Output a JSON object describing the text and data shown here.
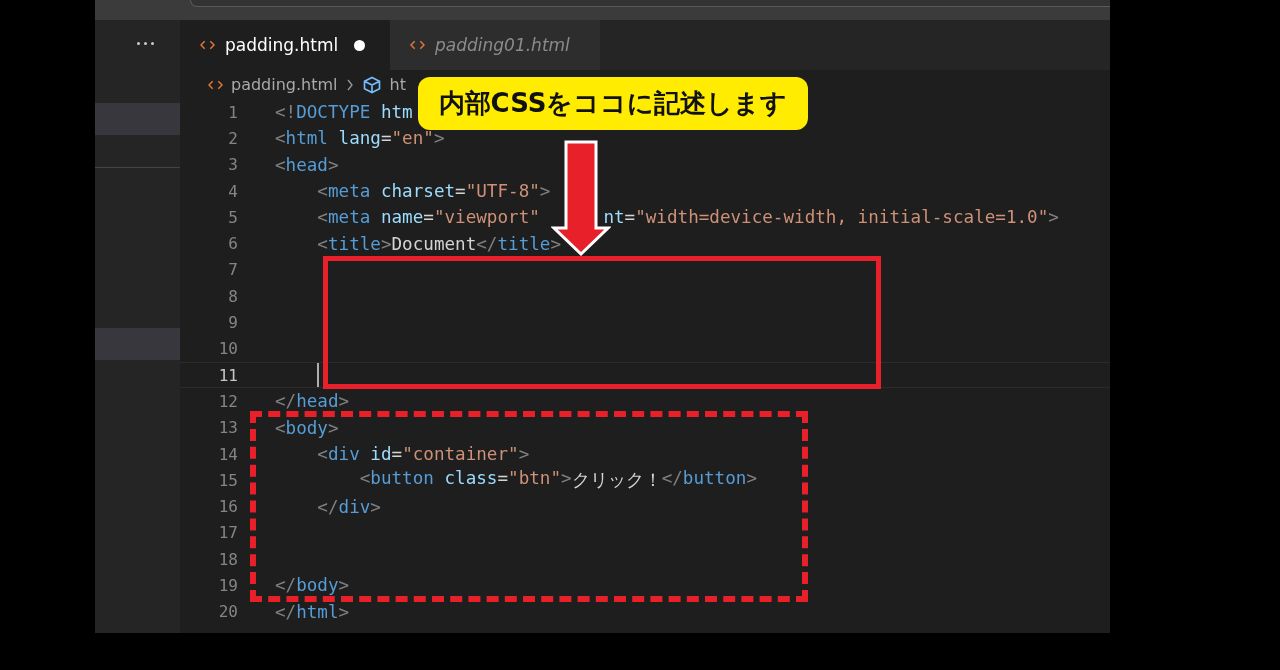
{
  "tabs": [
    {
      "label": "padding.html",
      "selected": true,
      "modified": true,
      "preview": false
    },
    {
      "label": "padding01.html",
      "selected": false,
      "modified": false,
      "preview": true
    }
  ],
  "breadcrumb": [
    "padding.html",
    "ht"
  ],
  "code_lines": [
    {
      "number": "1",
      "current": false,
      "tokens": [
        {
          "kind": "punct",
          "text": "<!"
        },
        {
          "kind": "tag",
          "text": "DOCTYPE"
        },
        {
          "kind": "attr",
          "text": " htm"
        }
      ]
    },
    {
      "number": "2",
      "current": false,
      "tokens": [
        {
          "kind": "punct",
          "text": "<"
        },
        {
          "kind": "tag",
          "text": "html"
        },
        {
          "kind": "attr",
          "text": " lang"
        },
        {
          "kind": "text",
          "text": "="
        },
        {
          "kind": "str",
          "text": "\"en\""
        },
        {
          "kind": "punct",
          "text": ">"
        }
      ]
    },
    {
      "number": "3",
      "current": false,
      "tokens": [
        {
          "kind": "punct",
          "text": "<"
        },
        {
          "kind": "tag",
          "text": "head"
        },
        {
          "kind": "punct",
          "text": ">"
        }
      ]
    },
    {
      "number": "4",
      "current": false,
      "tokens": [
        {
          "kind": "punct",
          "text": "    <"
        },
        {
          "kind": "tag",
          "text": "meta"
        },
        {
          "kind": "attr",
          "text": " charset"
        },
        {
          "kind": "text",
          "text": "="
        },
        {
          "kind": "str",
          "text": "\"UTF-8\""
        },
        {
          "kind": "punct",
          "text": ">"
        }
      ]
    },
    {
      "number": "5",
      "current": false,
      "tokens": [
        {
          "kind": "punct",
          "text": "    <"
        },
        {
          "kind": "tag",
          "text": "meta"
        },
        {
          "kind": "attr",
          "text": " name"
        },
        {
          "kind": "text",
          "text": "="
        },
        {
          "kind": "str",
          "text": "\"viewport\""
        },
        {
          "kind": "gap"
        },
        {
          "kind": "attr",
          "text": "nt"
        },
        {
          "kind": "text",
          "text": "="
        },
        {
          "kind": "str",
          "text": "\"width=device-width, initial-scale=1.0\""
        },
        {
          "kind": "punct",
          "text": ">"
        }
      ]
    },
    {
      "number": "6",
      "current": false,
      "tokens": [
        {
          "kind": "punct",
          "text": "    <"
        },
        {
          "kind": "tag",
          "text": "title"
        },
        {
          "kind": "punct",
          "text": ">"
        },
        {
          "kind": "text",
          "text": "Document"
        },
        {
          "kind": "punct",
          "text": "</"
        },
        {
          "kind": "tag",
          "text": "title"
        },
        {
          "kind": "punct",
          "text": ">"
        }
      ]
    },
    {
      "number": "7",
      "current": false
    },
    {
      "number": "8",
      "current": false
    },
    {
      "number": "9",
      "current": false
    },
    {
      "number": "10",
      "current": false
    },
    {
      "number": "11",
      "current": true
    },
    {
      "number": "12",
      "current": false,
      "tokens": [
        {
          "kind": "punct",
          "text": "</"
        },
        {
          "kind": "tag",
          "text": "head"
        },
        {
          "kind": "punct",
          "text": ">"
        }
      ]
    },
    {
      "number": "13",
      "current": false,
      "tokens": [
        {
          "kind": "punct",
          "text": "<"
        },
        {
          "kind": "tag",
          "text": "body"
        },
        {
          "kind": "punct",
          "text": ">"
        }
      ]
    },
    {
      "number": "14",
      "current": false,
      "tokens": [
        {
          "kind": "punct",
          "text": "    <"
        },
        {
          "kind": "tag",
          "text": "div"
        },
        {
          "kind": "attr",
          "text": " id"
        },
        {
          "kind": "text",
          "text": "="
        },
        {
          "kind": "str",
          "text": "\"container\""
        },
        {
          "kind": "punct",
          "text": ">"
        }
      ]
    },
    {
      "number": "15",
      "current": false,
      "tokens": [
        {
          "kind": "punct",
          "text": "        <"
        },
        {
          "kind": "tag",
          "text": "button"
        },
        {
          "kind": "attr",
          "text": " class"
        },
        {
          "kind": "text",
          "text": "="
        },
        {
          "kind": "str",
          "text": "\"btn\""
        },
        {
          "kind": "punct",
          "text": ">"
        },
        {
          "kind": "text",
          "text": "クリック！"
        },
        {
          "kind": "punct",
          "text": "</"
        },
        {
          "kind": "tag",
          "text": "button"
        },
        {
          "kind": "punct",
          "text": ">"
        }
      ]
    },
    {
      "number": "16",
      "current": false,
      "tokens": [
        {
          "kind": "punct",
          "text": "    </"
        },
        {
          "kind": "tag",
          "text": "div"
        },
        {
          "kind": "punct",
          "text": ">"
        }
      ]
    },
    {
      "number": "17",
      "current": false
    },
    {
      "number": "18",
      "current": false
    },
    {
      "number": "19",
      "current": false,
      "tokens": [
        {
          "kind": "punct",
          "text": "</"
        },
        {
          "kind": "tag",
          "text": "body"
        },
        {
          "kind": "punct",
          "text": ">"
        }
      ]
    },
    {
      "number": "20",
      "current": false,
      "tokens": [
        {
          "kind": "punct",
          "text": "</"
        },
        {
          "kind": "tag",
          "text": "html"
        },
        {
          "kind": "punct",
          "text": ">"
        }
      ]
    }
  ],
  "annotations": [
    {
      "kind": "solid-frame"
    },
    {
      "kind": "dashed-frame"
    },
    {
      "kind": "arrow"
    },
    {
      "kind": "callout",
      "text": "内部CSSをココに記述します"
    }
  ]
}
